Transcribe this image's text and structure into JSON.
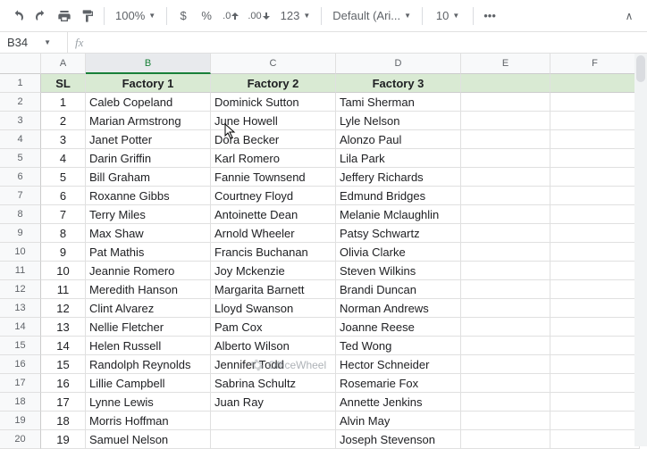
{
  "toolbar": {
    "zoom": "100%",
    "currency": "$",
    "percent": "%",
    "dec_less": ".0",
    "dec_more": ".00",
    "more_formats": "123",
    "font": "Default (Ari...",
    "font_size": "10",
    "more": "•••"
  },
  "namebox": "B34",
  "fx_label": "fx",
  "columns": [
    "A",
    "B",
    "C",
    "D",
    "E",
    "F"
  ],
  "header_row": {
    "A": "SL",
    "B": "Factory 1",
    "C": "Factory 2",
    "D": "Factory 3"
  },
  "rows": [
    {
      "n": "1"
    },
    {
      "n": "2",
      "A": "1",
      "B": "Caleb Copeland",
      "C": "Dominick Sutton",
      "D": "Tami Sherman"
    },
    {
      "n": "3",
      "A": "2",
      "B": "Marian Armstrong",
      "C": "June Howell",
      "D": "Lyle Nelson"
    },
    {
      "n": "4",
      "A": "3",
      "B": "Janet Potter",
      "C": "Dora Becker",
      "D": "Alonzo Paul"
    },
    {
      "n": "5",
      "A": "4",
      "B": "Darin Griffin",
      "C": "Karl Romero",
      "D": "Lila Park"
    },
    {
      "n": "6",
      "A": "5",
      "B": "Bill Graham",
      "C": "Fannie Townsend",
      "D": "Jeffery Richards"
    },
    {
      "n": "7",
      "A": "6",
      "B": "Roxanne Gibbs",
      "C": "Courtney Floyd",
      "D": "Edmund Bridges"
    },
    {
      "n": "8",
      "A": "7",
      "B": "Terry Miles",
      "C": "Antoinette Dean",
      "D": "Melanie Mclaughlin"
    },
    {
      "n": "9",
      "A": "8",
      "B": "Max Shaw",
      "C": "Arnold Wheeler",
      "D": "Patsy Schwartz"
    },
    {
      "n": "10",
      "A": "9",
      "B": "Pat Mathis",
      "C": "Francis Buchanan",
      "D": "Olivia Clarke"
    },
    {
      "n": "11",
      "A": "10",
      "B": "Jeannie Romero",
      "C": "Joy Mckenzie",
      "D": "Steven Wilkins"
    },
    {
      "n": "12",
      "A": "11",
      "B": "Meredith Hanson",
      "C": "Margarita Barnett",
      "D": "Brandi Duncan"
    },
    {
      "n": "13",
      "A": "12",
      "B": "Clint Alvarez",
      "C": "Lloyd Swanson",
      "D": "Norman Andrews"
    },
    {
      "n": "14",
      "A": "13",
      "B": "Nellie Fletcher",
      "C": "Pam Cox",
      "D": "Joanne Reese"
    },
    {
      "n": "15",
      "A": "14",
      "B": "Helen Russell",
      "C": "Alberto Wilson",
      "D": "Ted Wong"
    },
    {
      "n": "16",
      "A": "15",
      "B": "Randolph Reynolds",
      "C": "Jennifer Todd",
      "D": "Hector Schneider"
    },
    {
      "n": "17",
      "A": "16",
      "B": "Lillie Campbell",
      "C": "Sabrina Schultz",
      "D": "Rosemarie Fox"
    },
    {
      "n": "18",
      "A": "17",
      "B": "Lynne Lewis",
      "C": "Juan Ray",
      "D": "Annette Jenkins"
    },
    {
      "n": "19",
      "A": "18",
      "B": "Morris Hoffman",
      "C": "",
      "D": "Alvin May"
    },
    {
      "n": "20",
      "A": "19",
      "B": "Samuel Nelson",
      "C": "",
      "D": "Joseph Stevenson"
    }
  ],
  "watermark": "OfficeWheel"
}
